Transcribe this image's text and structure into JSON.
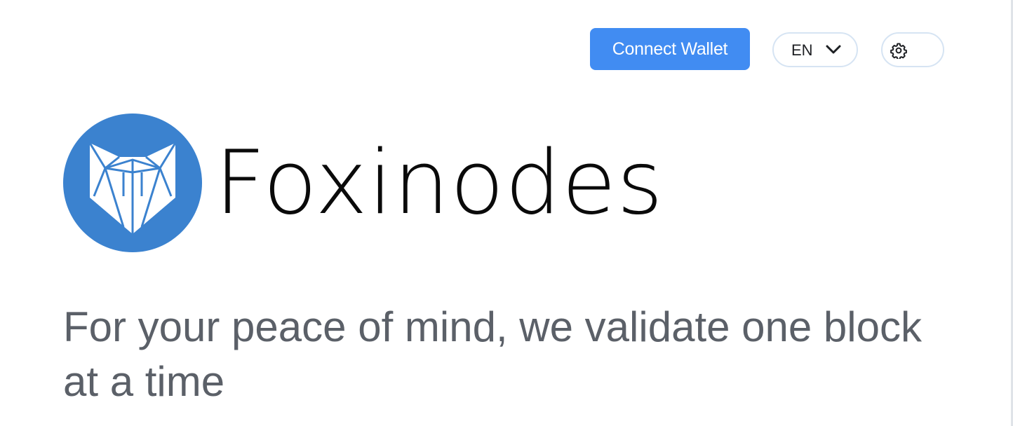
{
  "header": {
    "connect_wallet_label": "Connect Wallet",
    "language": {
      "selected": "EN",
      "icon": "chevron-down-icon"
    },
    "settings_icon": "gear-icon"
  },
  "hero": {
    "logo_icon": "fox-logo-icon",
    "brand_name": "Foxinodes",
    "tagline": "For your peace of mind, we validate one block at a time"
  },
  "colors": {
    "accent": "#418cf2",
    "logo_blue": "#3b82cf",
    "pill_border": "#d6e4f3",
    "tagline_text": "#5b6068",
    "brand_text": "#0a0a0a"
  }
}
